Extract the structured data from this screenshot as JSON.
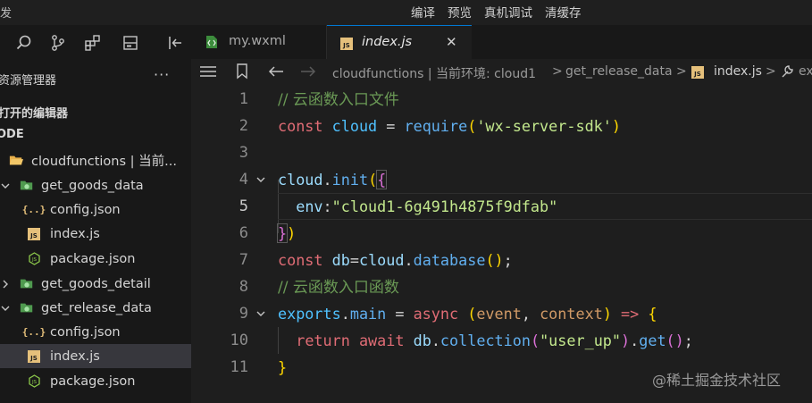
{
  "topbar": {
    "app_title": "发",
    "menu": [
      "编译",
      "预览",
      "真机调试",
      "清缓存"
    ]
  },
  "activity_bar": {
    "icons": [
      "search-icon",
      "source-control-icon",
      "extensions-icon",
      "storage-icon",
      "debugger-icon"
    ]
  },
  "sidebar": {
    "title": "资源管理器",
    "more": "···",
    "open_editors": "打开的编辑器",
    "root": "ODE",
    "tree": [
      {
        "label": "cloudfunctions | 当前...",
        "kind": "folder-open",
        "depth": 0,
        "arrow": "",
        "selected": false
      },
      {
        "label": "get_goods_data",
        "kind": "cloud-folder",
        "depth": 1,
        "arrow": "down",
        "selected": false
      },
      {
        "label": "config.json",
        "kind": "json",
        "depth": 2,
        "arrow": "",
        "selected": false
      },
      {
        "label": "index.js",
        "kind": "js",
        "depth": 2,
        "arrow": "",
        "selected": false
      },
      {
        "label": "package.json",
        "kind": "node",
        "depth": 2,
        "arrow": "",
        "selected": false
      },
      {
        "label": "get_goods_detail",
        "kind": "cloud-folder",
        "depth": 1,
        "arrow": "right",
        "selected": false
      },
      {
        "label": "get_release_data",
        "kind": "cloud-folder",
        "depth": 1,
        "arrow": "down",
        "selected": false
      },
      {
        "label": "config.json",
        "kind": "json",
        "depth": 2,
        "arrow": "",
        "selected": false
      },
      {
        "label": "index.js",
        "kind": "js",
        "depth": 2,
        "arrow": "",
        "selected": true
      },
      {
        "label": "package.json",
        "kind": "node",
        "depth": 2,
        "arrow": "",
        "selected": false
      }
    ]
  },
  "tabs": [
    {
      "label": "my.wxml",
      "icon": "wxml-file-icon",
      "active": false
    },
    {
      "label": "index.js",
      "icon": "js-file-icon",
      "active": true,
      "close": "✕"
    }
  ],
  "breadcrumb": {
    "segments": [
      "cloudfunctions | 当前环境: cloud1",
      "get_release_data",
      "index.js"
    ],
    "separator": ">",
    "tail": "ex"
  },
  "editor": {
    "current_line": 5,
    "lines": [
      {
        "n": "1",
        "fold": ""
      },
      {
        "n": "2",
        "fold": ""
      },
      {
        "n": "3",
        "fold": ""
      },
      {
        "n": "4",
        "fold": "down"
      },
      {
        "n": "5",
        "fold": ""
      },
      {
        "n": "6",
        "fold": ""
      },
      {
        "n": "7",
        "fold": ""
      },
      {
        "n": "8",
        "fold": ""
      },
      {
        "n": "9",
        "fold": "down"
      },
      {
        "n": "10",
        "fold": ""
      },
      {
        "n": "11",
        "fold": ""
      }
    ],
    "code": {
      "l1_comment": "// 云函数入口文件",
      "l2_const": "const",
      "l2_var": "cloud",
      "l2_eq": " = ",
      "l2_fn": "require",
      "l2_str": "'wx-server-sdk'",
      "l4_obj": "cloud",
      "l4_fn": "init",
      "l5_key": "env",
      "l5_str": "\"cloud1-6g491h4875f9dfab\"",
      "l7_const": "const",
      "l7_var": "db",
      "l7_obj": "cloud",
      "l7_fn": "database",
      "l8_comment": "// 云函数入口函数",
      "l9_obj": "exports",
      "l9_prop": "main",
      "l9_async": "async",
      "l9_p1": "event",
      "l9_p2": "context",
      "l9_arrow": "=>",
      "l10_return": "return",
      "l10_await": "await",
      "l10_db": "db",
      "l10_fn": "collection",
      "l10_str": "\"user_up\"",
      "l10_get": "get"
    }
  },
  "watermark": "@稀土掘金技术社区",
  "colors": {
    "accent": "#0078d4",
    "comment": "#6a9955",
    "keyword": "#e06c75",
    "string": "#ce9178",
    "js_badge": "#e5c07b",
    "folder": "#e8b04b",
    "cloud_folder": "#6cbf6c"
  }
}
